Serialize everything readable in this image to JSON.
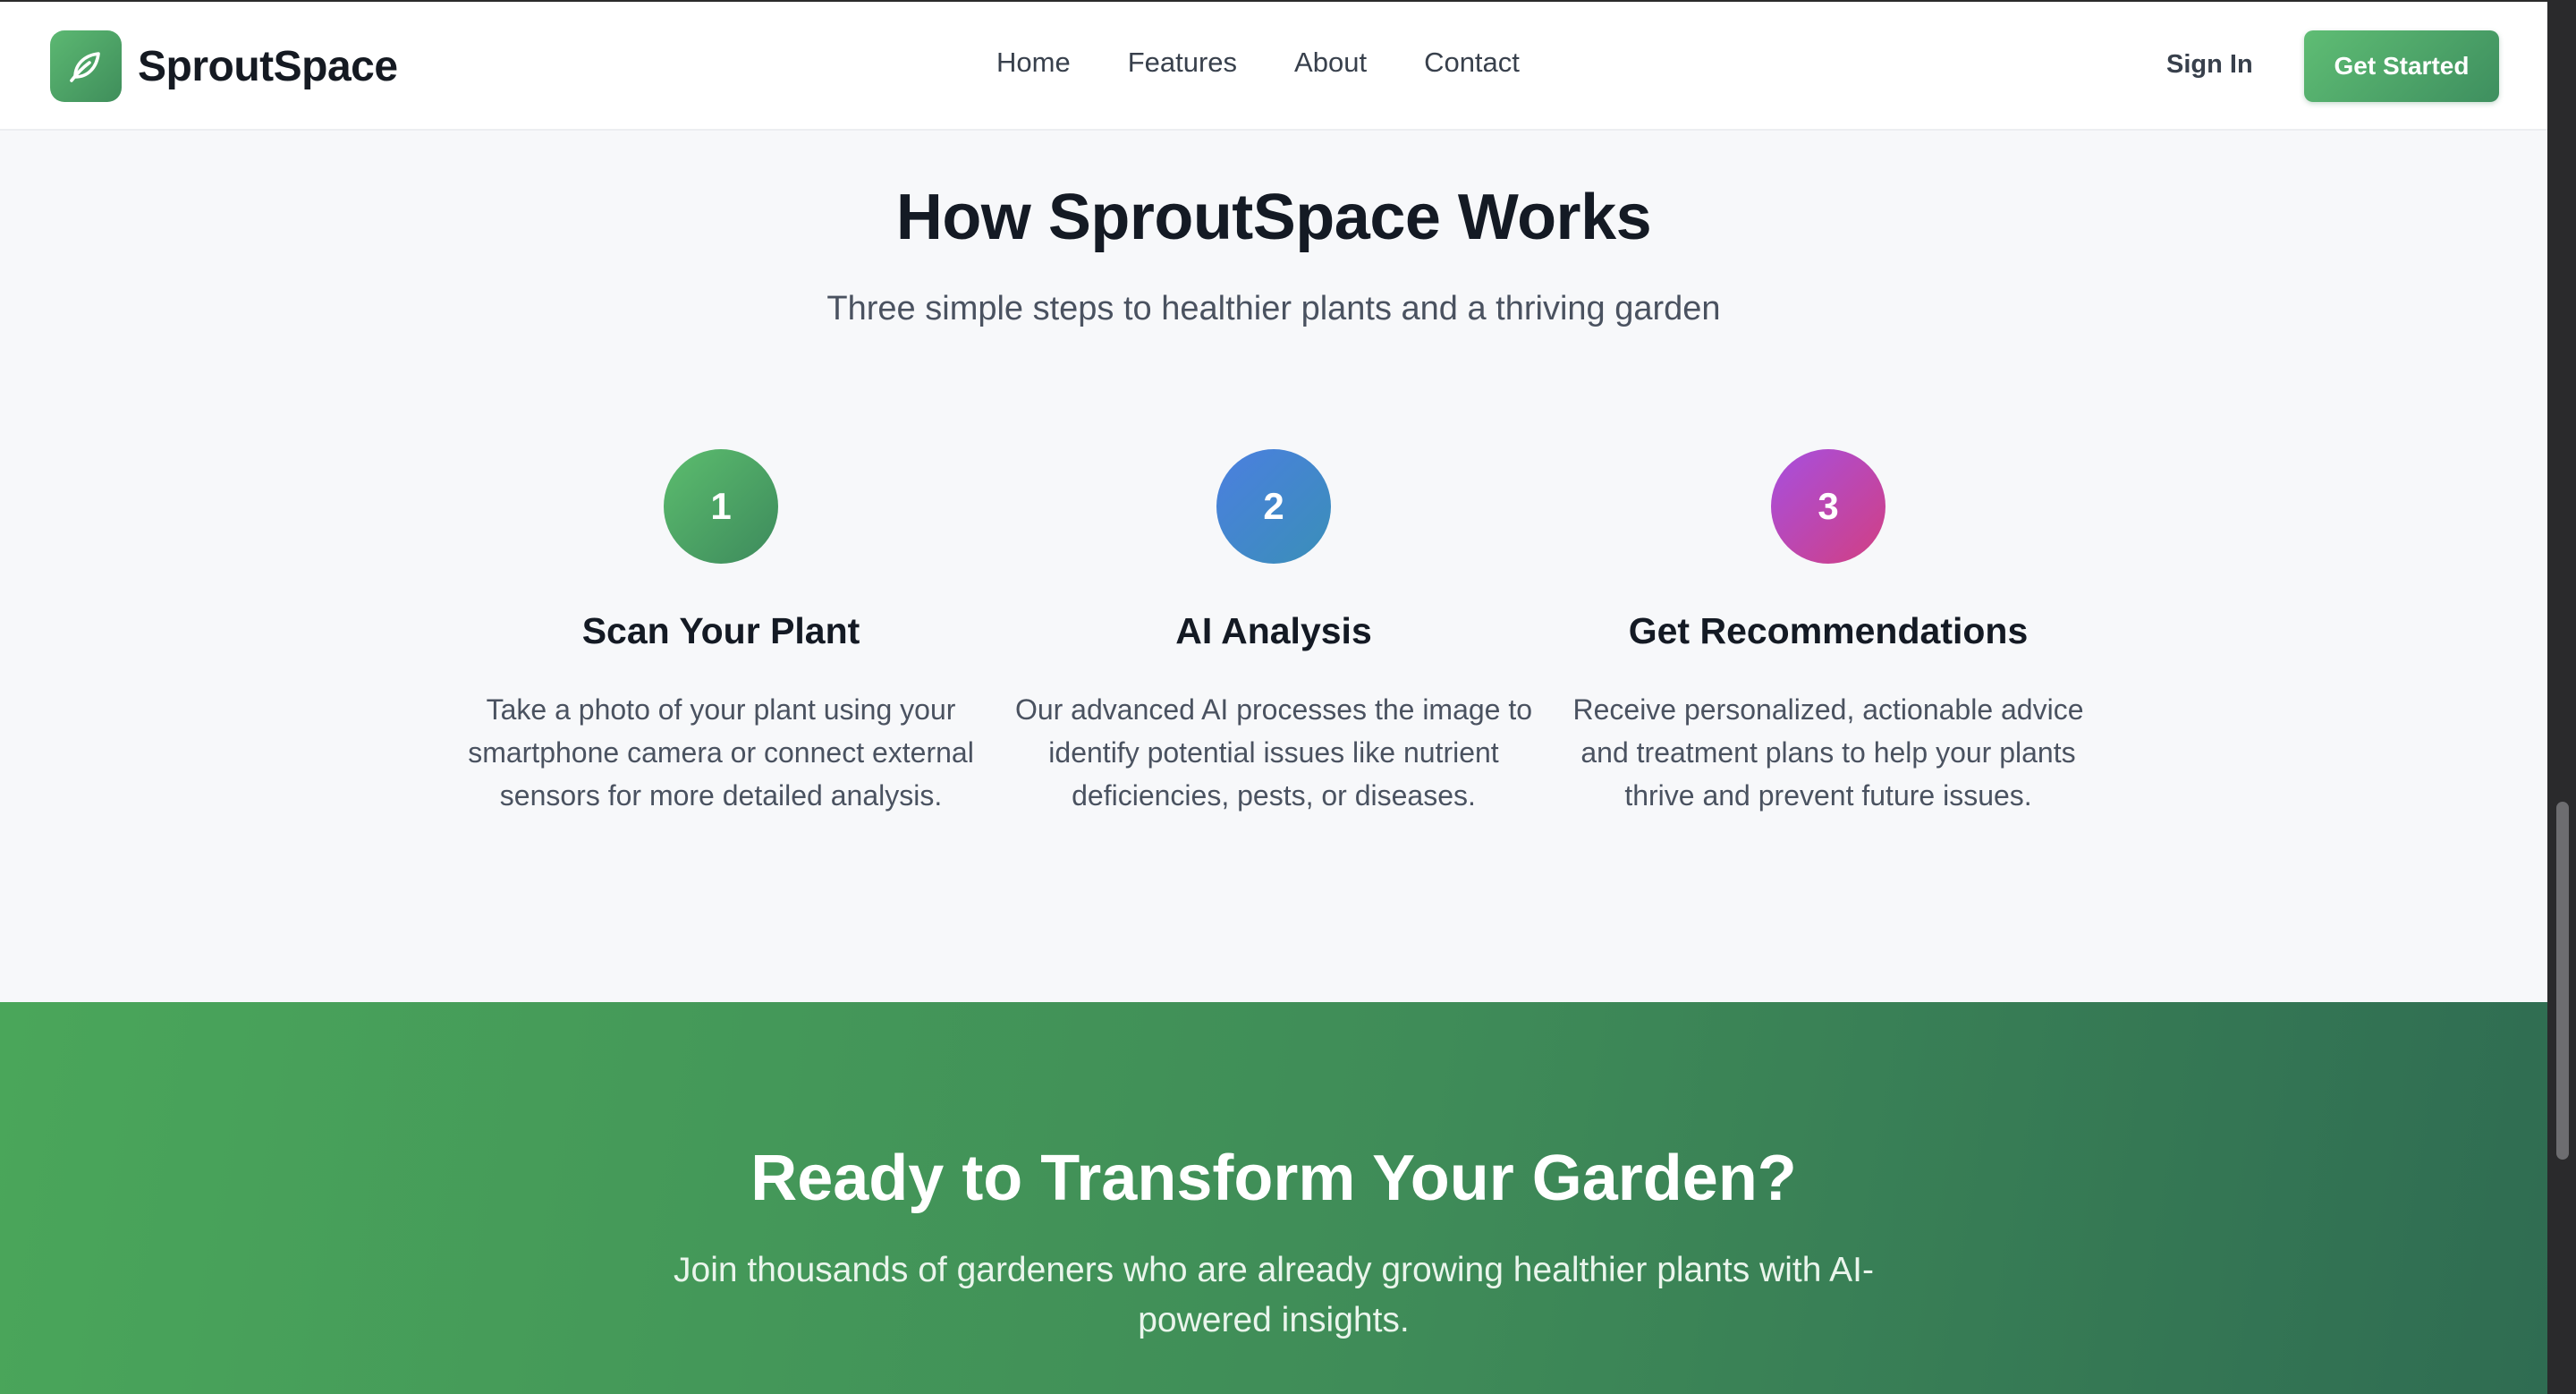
{
  "brand": {
    "name": "SproutSpace",
    "logo_icon": "leaf-icon"
  },
  "nav": {
    "items": [
      {
        "label": "Home"
      },
      {
        "label": "Features"
      },
      {
        "label": "About"
      },
      {
        "label": "Contact"
      }
    ],
    "sign_in": "Sign In",
    "get_started": "Get Started"
  },
  "how": {
    "title": "How SproutSpace Works",
    "subtitle": "Three simple steps to healthier plants and a thriving garden",
    "steps": [
      {
        "number": "1",
        "title": "Scan Your Plant",
        "description": "Take a photo of your plant using your smartphone camera or connect external sensors for more detailed analysis.",
        "color_from": "#5cbd6e",
        "color_to": "#3d8a5c"
      },
      {
        "number": "2",
        "title": "AI Analysis",
        "description": "Our advanced AI processes the image to identify potential issues like nutrient deficiencies, pests, or diseases.",
        "color_from": "#4b7fe0",
        "color_to": "#3a8fb8"
      },
      {
        "number": "3",
        "title": "Get Recommendations",
        "description": "Receive personalized, actionable advice and treatment plans to help your plants thrive and prevent future issues.",
        "color_from": "#a64fe0",
        "color_to": "#d23f82"
      }
    ]
  },
  "cta": {
    "title": "Ready to Transform Your Garden?",
    "subtitle": "Join thousands of gardeners who are already growing healthier plants with AI-powered insights."
  },
  "colors": {
    "accent": "#4aa65a",
    "accent_dark": "#2f6c52",
    "text_dark": "#141a24",
    "text_muted": "#4a5260"
  }
}
